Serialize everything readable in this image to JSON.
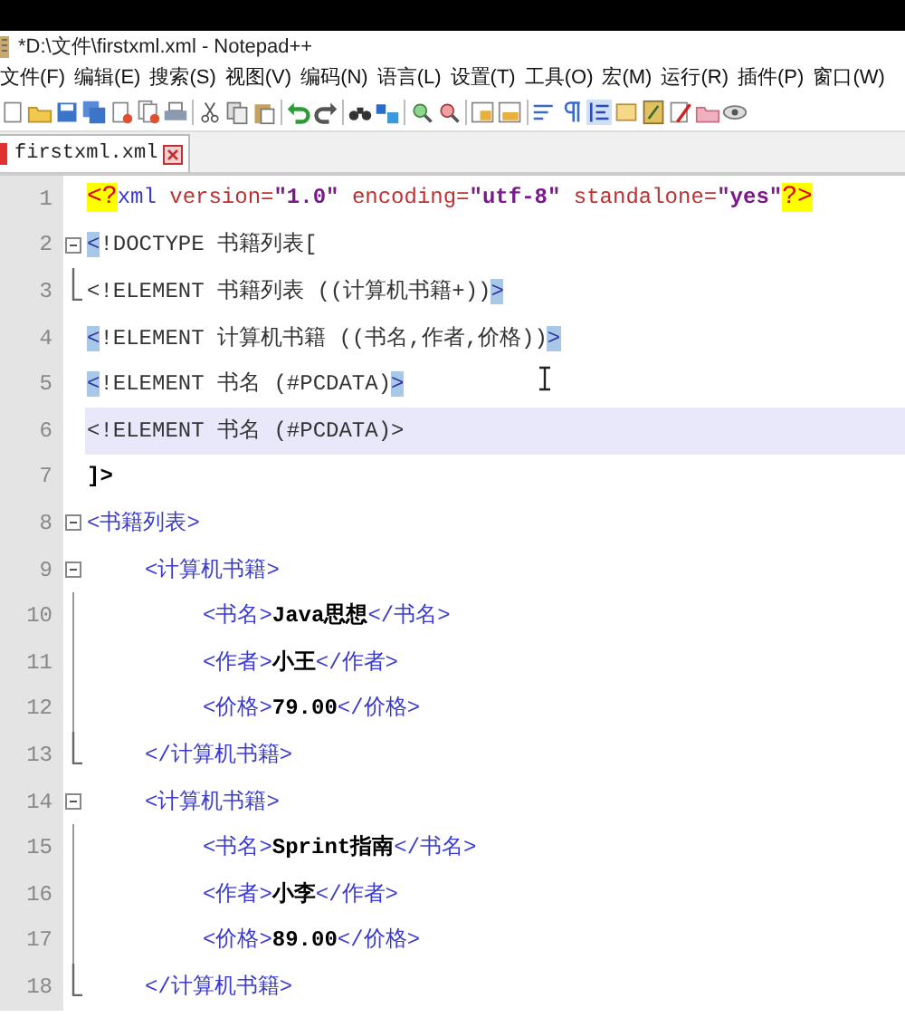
{
  "window": {
    "title": "*D:\\文件\\firstxml.xml - Notepad++"
  },
  "menu": [
    "文件(F)",
    "编辑(E)",
    "搜索(S)",
    "视图(V)",
    "编码(N)",
    "语言(L)",
    "设置(T)",
    "工具(O)",
    "宏(M)",
    "运行(R)",
    "插件(P)",
    "窗口(W)"
  ],
  "tabs": [
    {
      "label": "firstxml.xml",
      "selected": true,
      "modified": true
    }
  ],
  "editor": {
    "lines": [
      {
        "number": "1",
        "fold_box": false,
        "fold_end": false,
        "current": false,
        "tokens": [
          {
            "kind": "pi",
            "text": "<?"
          },
          {
            "kind": "tag",
            "text": "xml"
          },
          {
            "kind": "attr",
            "text": " version="
          },
          {
            "kind": "value",
            "text": "\"1.0\""
          },
          {
            "kind": "attr",
            "text": " encoding="
          },
          {
            "kind": "value",
            "text": "\"utf-8\""
          },
          {
            "kind": "attr",
            "text": " standalone="
          },
          {
            "kind": "value",
            "text": "\"yes\""
          },
          {
            "kind": "pi",
            "text": "?>"
          }
        ]
      },
      {
        "number": "2",
        "fold_box": true,
        "fold_end": false,
        "current": false,
        "tokens": [
          {
            "kind": "match",
            "text": "<"
          },
          {
            "kind": "dtd",
            "text": "!DOCTYPE 书籍列表["
          }
        ]
      },
      {
        "number": "3",
        "fold_box": false,
        "fold_end": true,
        "current": false,
        "tokens": [
          {
            "kind": "dtd",
            "text": "<!ELEMENT 书籍列表 ((计算机书籍+))"
          },
          {
            "kind": "match",
            "text": ">"
          }
        ]
      },
      {
        "number": "4",
        "fold_box": false,
        "fold_end": false,
        "current": false,
        "tokens": [
          {
            "kind": "match",
            "text": "<"
          },
          {
            "kind": "dtd",
            "text": "!ELEMENT 计算机书籍 ((书名,作者,价格))"
          },
          {
            "kind": "match",
            "text": ">"
          }
        ]
      },
      {
        "number": "5",
        "fold_box": false,
        "fold_end": false,
        "current": false,
        "tokens": [
          {
            "kind": "match",
            "text": "<"
          },
          {
            "kind": "dtd",
            "text": "!ELEMENT 书名 (#PCDATA)"
          },
          {
            "kind": "match",
            "text": ">"
          }
        ]
      },
      {
        "number": "6",
        "fold_box": false,
        "fold_end": false,
        "current": true,
        "tokens": [
          {
            "kind": "dtd",
            "text": "<!ELEMENT 书名 (#PCDATA)>"
          }
        ]
      },
      {
        "number": "7",
        "fold_box": false,
        "fold_end": false,
        "current": false,
        "tokens": [
          {
            "kind": "text",
            "text": "]>"
          }
        ]
      },
      {
        "number": "8",
        "fold_box": true,
        "fold_end": false,
        "current": false,
        "tokens": [
          {
            "kind": "tag",
            "text": "<书籍列表>"
          }
        ],
        "children": [
          {
            "number": "9",
            "fold_box": true,
            "fold_end": false,
            "current": false,
            "tokens": [
              {
                "kind": "tag",
                "text": "<计算机书籍>"
              }
            ],
            "children": [
              {
                "number": "10",
                "fold_box": false,
                "fold_end": false,
                "current": false,
                "tokens": [
                  {
                    "kind": "tag",
                    "text": "<书名>"
                  },
                  {
                    "kind": "text",
                    "text": "Java思想"
                  },
                  {
                    "kind": "tag",
                    "text": "</书名>"
                  }
                ]
              },
              {
                "number": "11",
                "fold_box": false,
                "fold_end": false,
                "current": false,
                "tokens": [
                  {
                    "kind": "tag",
                    "text": "<作者>"
                  },
                  {
                    "kind": "text",
                    "text": "小王"
                  },
                  {
                    "kind": "tag",
                    "text": "</作者>"
                  }
                ]
              },
              {
                "number": "12",
                "fold_box": false,
                "fold_end": false,
                "current": false,
                "tokens": [
                  {
                    "kind": "tag",
                    "text": "<价格>"
                  },
                  {
                    "kind": "text",
                    "text": "79.00"
                  },
                  {
                    "kind": "tag",
                    "text": "</价格>"
                  }
                ]
              }
            ]
          },
          {
            "number": "13",
            "fold_box": false,
            "fold_end": true,
            "current": false,
            "tokens": [
              {
                "kind": "tag",
                "text": "</计算机书籍>"
              }
            ]
          },
          {
            "number": "14",
            "fold_box": true,
            "fold_end": false,
            "current": false,
            "tokens": [
              {
                "kind": "tag",
                "text": "<计算机书籍>"
              }
            ],
            "children": [
              {
                "number": "15",
                "fold_box": false,
                "fold_end": false,
                "current": false,
                "tokens": [
                  {
                    "kind": "tag",
                    "text": "<书名>"
                  },
                  {
                    "kind": "text",
                    "text": "Sprint指南"
                  },
                  {
                    "kind": "tag",
                    "text": "</书名>"
                  }
                ]
              },
              {
                "number": "16",
                "fold_box": false,
                "fold_end": false,
                "current": false,
                "tokens": [
                  {
                    "kind": "tag",
                    "text": "<作者>"
                  },
                  {
                    "kind": "text",
                    "text": "小李"
                  },
                  {
                    "kind": "tag",
                    "text": "</作者>"
                  }
                ]
              },
              {
                "number": "17",
                "fold_box": false,
                "fold_end": false,
                "current": false,
                "tokens": [
                  {
                    "kind": "tag",
                    "text": "<价格>"
                  },
                  {
                    "kind": "text",
                    "text": "89.00"
                  },
                  {
                    "kind": "tag",
                    "text": "</价格>"
                  }
                ]
              }
            ]
          },
          {
            "number": "18",
            "fold_box": false,
            "fold_end": true,
            "current": false,
            "tokens": [
              {
                "kind": "tag",
                "text": "</计算机书籍>"
              }
            ]
          }
        ]
      }
    ]
  }
}
